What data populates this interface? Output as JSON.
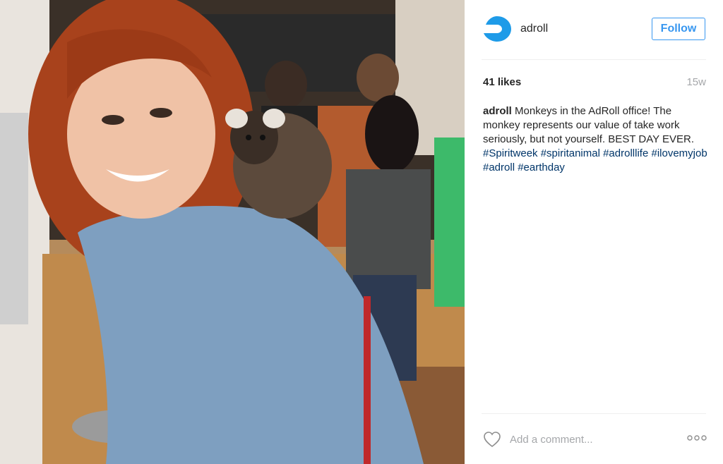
{
  "post": {
    "image": {
      "description_icon": "photo-icon"
    }
  },
  "header": {
    "username": "adroll",
    "follow_label": "Follow",
    "avatar_icon": "adroll-logo-icon"
  },
  "stats": {
    "likes": "41 likes",
    "time": "15w"
  },
  "caption": {
    "username": "adroll",
    "text": "Monkeys in the AdRoll office! The monkey represents our value of take work seriously, but not yourself. BEST DAY EVER.",
    "tags": [
      "#Spiritweek",
      "#spiritanimal",
      "#adrolllife",
      "#ilovemyjob",
      "#adroll",
      "#earthday"
    ]
  },
  "footer": {
    "like_icon": "heart-icon",
    "comment_placeholder": "Add a comment...",
    "more_icon": "more-options-icon"
  },
  "colors": {
    "link": "#003569",
    "follow": "#3897f0",
    "brand": "#1E9BE8"
  }
}
